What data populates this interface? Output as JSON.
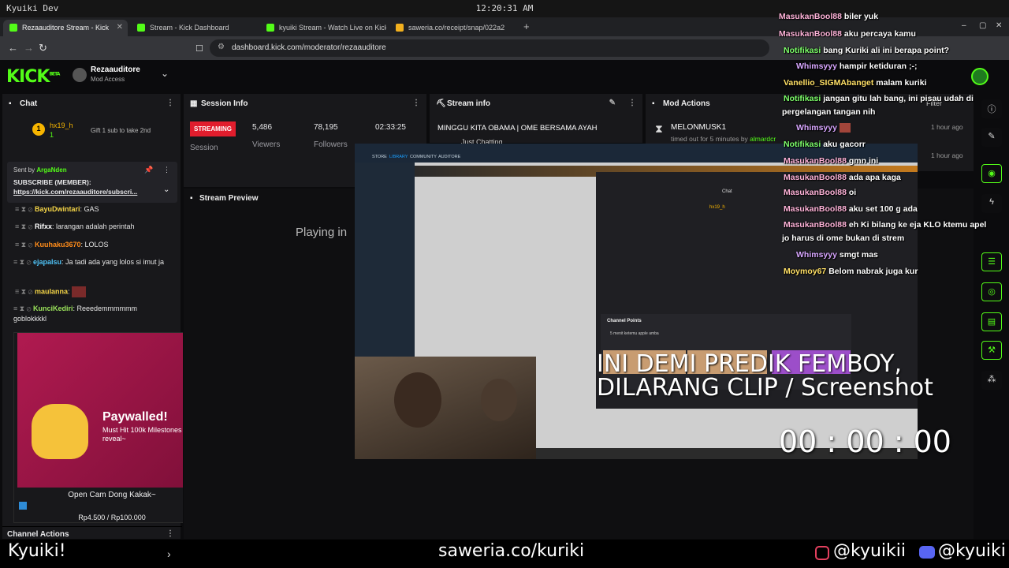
{
  "os_bar": {
    "left": "Kyuiki Dev",
    "clock": "12:20:31 AM"
  },
  "tabs": [
    {
      "label": "Rezaauditore Stream - Kick",
      "active": true
    },
    {
      "label": "Stream - Kick Dashboard"
    },
    {
      "label": "kyuiki Stream - Watch Live on Kick"
    },
    {
      "label": "saweria.co/receipt/snap/022a2"
    }
  ],
  "address": {
    "url": "dashboard.kick.com/moderator/rezaauditore"
  },
  "header": {
    "logo": "KICK",
    "logo_sup": "BETA",
    "channel": "Rezaauditore",
    "role": "Mod Access"
  },
  "chat": {
    "title": "Chat",
    "gift_user": "hx19_h",
    "gift_count": "1",
    "gift_text": "Gift 1 sub to take 2nd",
    "pinned_by_label": "Sent by",
    "pinned_by_user": "ArgaNden",
    "pinned_text": "SUBSCRIBE (MEMBER):",
    "pinned_link": "https://kick.com/rezaauditore/subscri...",
    "messages": [
      {
        "user": "BayuDwintari",
        "text": ": GAS",
        "color": "#f5d547"
      },
      {
        "user": "Rifxx",
        "text": ": larangan adalah perintah",
        "color": "#ffffff"
      },
      {
        "user": "Kuuhaku3670",
        "text": ": LOLOS",
        "color": "#ff8c1a"
      },
      {
        "user": "ejapalsu",
        "text": ": Ja tadi ada yang lolos si imut ja",
        "color": "#4fc3f7"
      },
      {
        "user": "maulanna",
        "text": ":",
        "color": "#f5d547"
      },
      {
        "user": "KunciKediri",
        "text": ": Reeedemmmmmm goblokkkkl",
        "color": "#9be35b"
      }
    ],
    "reward": {
      "title": "Paywalled!",
      "sub": "Must Hit 100k Milestones to reveal~",
      "caption": "Open Cam Dong Kakak~",
      "price": "Rp4.500 / Rp100.000"
    },
    "channel_actions": "Channel Actions"
  },
  "session": {
    "title": "Session Info",
    "badge": "STREAMING",
    "badge_label": "Session",
    "viewers": "5,486",
    "viewers_label": "Viewers",
    "followers": "78,195",
    "followers_label": "Followers",
    "time": "02:33:25"
  },
  "stream_info": {
    "title": "Stream info",
    "stream_title": "MINGGU KITA OBAMA | OME BERSAMA AYAH",
    "category": "Just Chatting"
  },
  "mod_actions": {
    "title": "Mod Actions",
    "filter": "Filter",
    "entries": [
      {
        "user": "MELONMUSK1",
        "detail": "timed out for 5 minutes by",
        "by": "almardcr",
        "time": "1 hour ago"
      },
      {
        "time": "1 hour ago"
      }
    ]
  },
  "preview": {
    "title": "Stream Preview",
    "playing": "Playing in"
  },
  "overlay": {
    "chat": [
      {
        "user": "MasukanBool88",
        "text": "biler yuk",
        "c": "n"
      },
      {
        "user": "MasukanBool88",
        "text": "aku percaya kamu",
        "c": "n"
      },
      {
        "user": "Notifikasi",
        "text": "bang Kuriki ali ini berapa point?",
        "c": "g"
      },
      {
        "user": "Whimsyyy",
        "text": "hampir ketiduran ;-;",
        "c": "p"
      },
      {
        "user": "Vanellio_SIGMAbanget",
        "text": "malam kuriki",
        "c": "y"
      },
      {
        "user": "Notifikasi",
        "text": "jangan gitu lah bang, ini pisau udah di",
        "c": "g"
      },
      {
        "user": "",
        "text": "pergelangan tangan nih",
        "c": "g"
      },
      {
        "user": "Whimsyyy",
        "text": "",
        "c": "p"
      },
      {
        "user": "Notifikasi",
        "text": "aku gacorr",
        "c": "g"
      },
      {
        "user": "MasukanBool88",
        "text": "gmn ini",
        "c": "n"
      },
      {
        "user": "MasukanBool88",
        "text": "ada apa kaga",
        "c": "n"
      },
      {
        "user": "MasukanBool88",
        "text": "oi",
        "c": "n"
      },
      {
        "user": "MasukanBool88",
        "text": "aku set 100 g ada",
        "c": "n"
      },
      {
        "user": "MasukanBool88",
        "text": "eh Ki bilang ke eja KLO ktemu apel",
        "c": "n"
      },
      {
        "user": "",
        "text": "jo harus di ome bukan di strem",
        "c": "n"
      },
      {
        "user": "Whimsyyy",
        "text": "smgt mas",
        "c": "p"
      },
      {
        "user": "Moymoy67",
        "text": "Belom nabrak juga kur",
        "c": "y"
      }
    ],
    "banner_line1": "INI DEMI PREDIK FEMBOY,",
    "banner_line2": "DILARANG CLIP / Screenshot",
    "timer": "00 : 00 : 00"
  },
  "inner": {
    "tabs": [
      "STORE",
      "LIBRARY",
      "COMMUNITY",
      "AUDITORE"
    ],
    "chat_title": "Chat",
    "gift_user": "hx19_h",
    "channel_points": "Channel Points",
    "prediction_title": "5 menit ketemu apple amba"
  },
  "bottom": {
    "left": "Kyuiki!",
    "center": "saweria.co/kuriki",
    "ig": "@kyuikii",
    "discord": "@kyuiki"
  },
  "colors": {
    "kick_green": "#53fc18",
    "streaming_red": "#e11d2d",
    "banner_pink": "#c45cff",
    "banner_peach": "#ffc48a"
  }
}
